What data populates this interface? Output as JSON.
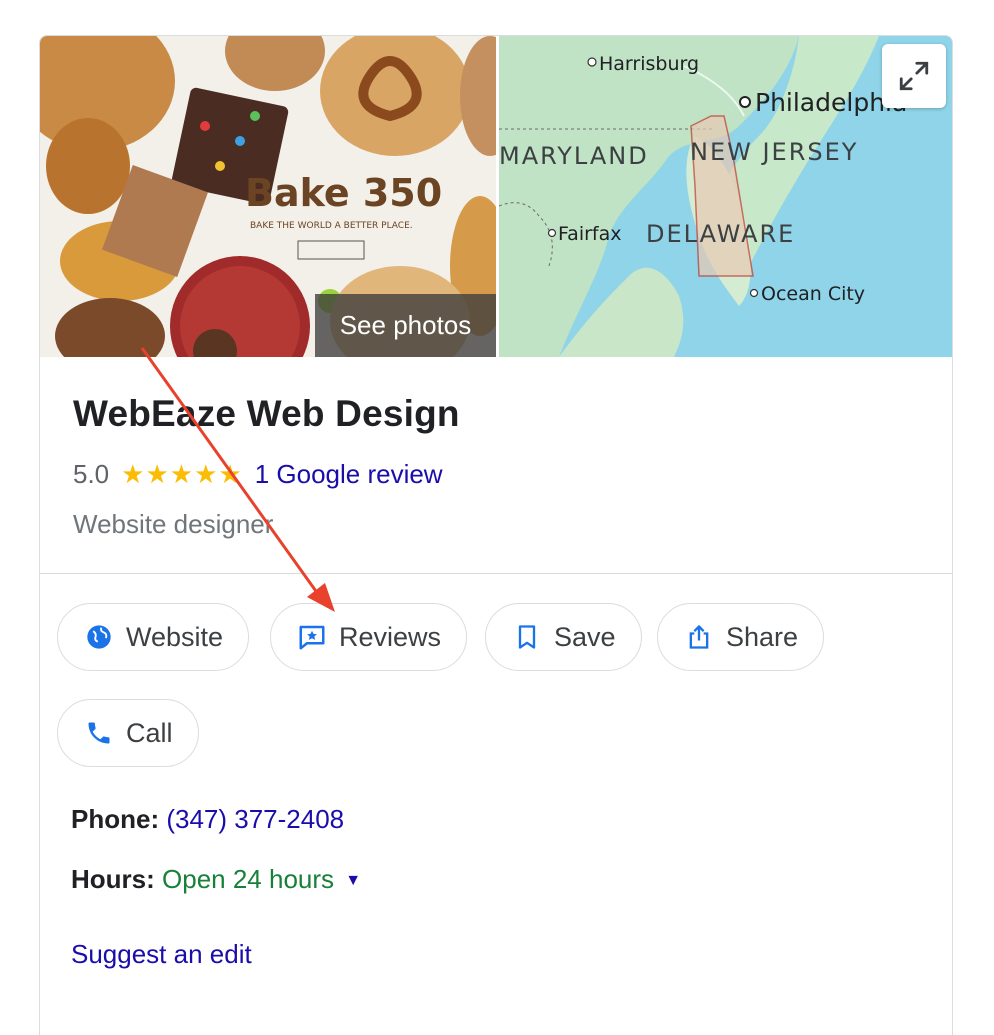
{
  "media": {
    "see_photos_label": "See photos",
    "photo_brand_text": "Bake 350",
    "photo_tagline": "BAKE THE WORLD A BETTER PLACE.",
    "map_labels": {
      "harrisburg": "Harrisburg",
      "philadelphia": "Philadelphia",
      "maryland": "MARYLAND",
      "new_jersey": "NEW JERSEY",
      "fairfax": "Fairfax",
      "delaware": "DELAWARE",
      "ocean_city": "Ocean City"
    }
  },
  "business": {
    "name": "WebEaze Web Design",
    "rating": "5.0",
    "stars": "★★★★★",
    "review_link": "1 Google review",
    "category": "Website designer"
  },
  "actions": {
    "website": "Website",
    "reviews": "Reviews",
    "save": "Save",
    "share": "Share",
    "call": "Call"
  },
  "details": {
    "phone_label": "Phone:",
    "phone_value": "(347) 377-2408",
    "hours_label": "Hours:",
    "hours_value": "Open 24 hours"
  },
  "suggest_edit": "Suggest an edit",
  "colors": {
    "link": "#1a0dab",
    "open": "#188038",
    "star": "#fbbc04",
    "icon_blue": "#1a73e8",
    "annotation_arrow": "#e8412c"
  }
}
